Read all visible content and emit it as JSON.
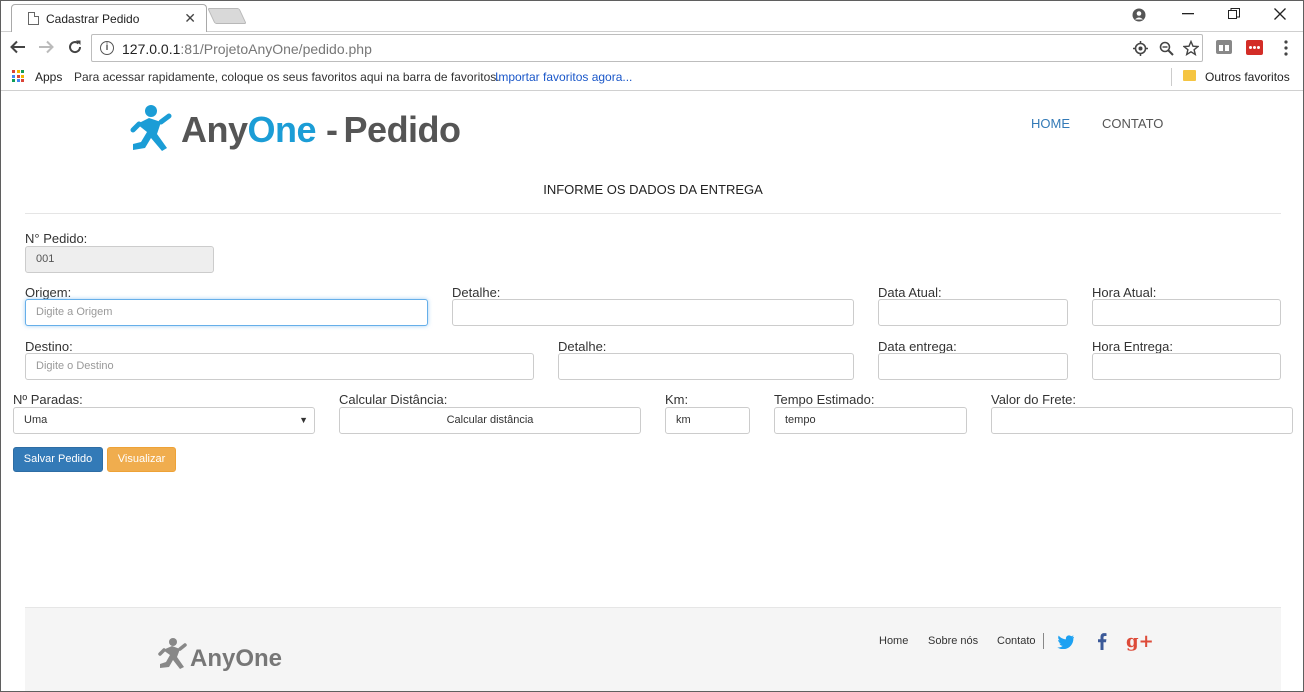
{
  "browser": {
    "tab_title": "Cadastrar Pedido",
    "tab_close": "✕",
    "url_host": "127.0.0.1",
    "url_rest": ":81/ProjetoAnyOne/pedido.php",
    "bookmarks": {
      "apps": "Apps",
      "hint": "Para acessar rapidamente, coloque os seus favoritos aqui na barra de favoritos.",
      "import": "Importar favoritos agora...",
      "other": "Outros favoritos"
    }
  },
  "header": {
    "logo_any": "Any",
    "logo_one": "One",
    "logo_dash": "-",
    "logo_pedido": "Pedido",
    "nav": {
      "home": "HOME",
      "contato": "CONTATO"
    }
  },
  "form": {
    "title": "INFORME OS DADOS DA ENTREGA",
    "pedido": {
      "label": "N° Pedido:",
      "value": "001"
    },
    "origem": {
      "label": "Origem:",
      "placeholder": "Digite a Origem"
    },
    "detalhe1": {
      "label": "Detalhe:"
    },
    "data_atual": {
      "label": "Data Atual:"
    },
    "hora_atual": {
      "label": "Hora Atual:"
    },
    "destino": {
      "label": "Destino:",
      "placeholder": "Digite o Destino"
    },
    "detalhe2": {
      "label": "Detalhe:"
    },
    "data_entrega": {
      "label": "Data entrega:"
    },
    "hora_entrega": {
      "label": "Hora Entrega:"
    },
    "paradas": {
      "label": "Nº Paradas:",
      "selected": "Uma"
    },
    "calcular": {
      "label": "Calcular Distância:",
      "button": "Calcular distância"
    },
    "km": {
      "label": "Km:",
      "placeholder": "km"
    },
    "tempo": {
      "label": "Tempo Estimado:",
      "placeholder": "tempo"
    },
    "valor": {
      "label": "Valor do Frete:"
    },
    "salvar": "Salvar Pedido",
    "visualizar": "Visualizar"
  },
  "footer": {
    "logo": "AnyOne",
    "links": {
      "home": "Home",
      "sobre": "Sobre nós",
      "contato": "Contato"
    },
    "social": {
      "twitter": "twitter-icon",
      "facebook": "f",
      "google": "g+"
    }
  },
  "colors": {
    "brand": "#1b9dd6",
    "primary": "#337ab7",
    "warning": "#f0ad4e",
    "link": "#1a57c9"
  }
}
